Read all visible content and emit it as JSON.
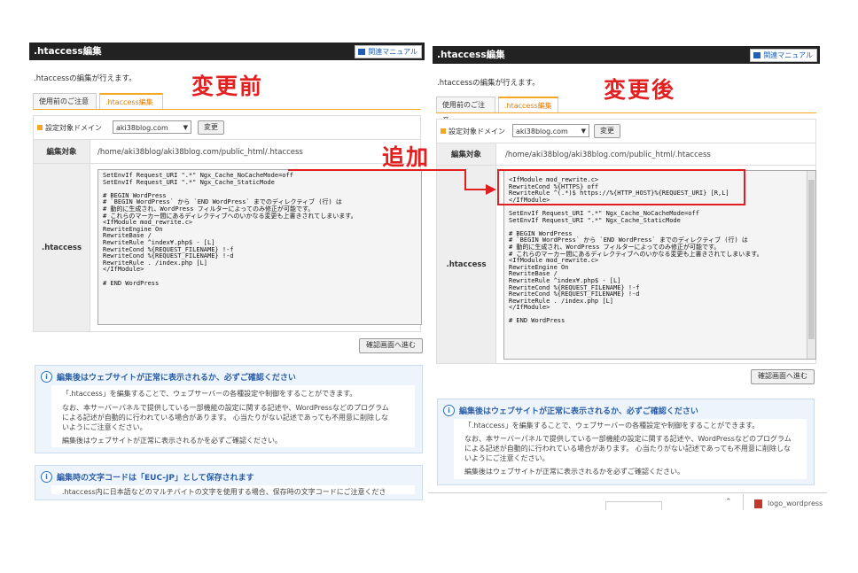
{
  "panel_title": ".htaccess編集",
  "manual_label": "関連マニュアル",
  "description": ".htaccessの編集が行えます。",
  "tabs": {
    "notice": "使用前のご注意",
    "edit": ".htaccess編集"
  },
  "domain_label": "設定対象ドメイン",
  "domain_value": "aki38blog.com",
  "change_button": "変更",
  "target_label": "編集対象",
  "target_path": "/home/aki38blog/aki38blog.com/public_html/.htaccess",
  "htaccess_label": ".htaccess",
  "confirm_button": "確認画面へ進む",
  "annotations": {
    "before": "変更前",
    "after": "変更後",
    "added": "追加"
  },
  "code_before": [
    "SetEnvIf Request_URI \".*\" Ngx_Cache_NoCacheMode=off",
    "SetEnvIf Request_URI \".*\" Ngx_Cache_StaticMode",
    "",
    "# BEGIN WordPress",
    "# `BEGIN WordPress` から `END WordPress` までのディレクティブ (行) は",
    "# 動的に生成され、WordPress フィルターによってのみ修正が可能です。",
    "# これらのマーカー間にあるディレクティブへのいかなる変更も上書きされてしまいます。",
    "<IfModule mod_rewrite.c>",
    "RewriteEngine On",
    "RewriteBase /",
    "RewriteRule ^index¥.php$ - [L]",
    "RewriteCond %{REQUEST_FILENAME} !-f",
    "RewriteCond %{REQUEST_FILENAME} !-d",
    "RewriteRule . /index.php [L]",
    "</IfModule>",
    "",
    "# END WordPress"
  ],
  "code_added": [
    "<IfModule mod_rewrite.c>",
    "RewriteCond %{HTTPS} off",
    "RewriteRule ^(.*)$ https://%{HTTP_HOST}%{REQUEST_URI} [R,L]",
    "</IfModule>"
  ],
  "info1": {
    "title": "編集後はウェブサイトが正常に表示されるか、必ずご確認ください",
    "line1": "「.htaccess」を編集することで、ウェブサーバーの各種設定や制御をすることができます。",
    "line2a": "なお、本サーバーパネルで提供している一部機能の設定に関する記述や、WordPressなどのプログラム",
    "line2b": "による記述が自動的に行われている場合があります。 心当たりがない記述であっても不用意に削除しな",
    "line2c": "いようにご注意ください。",
    "line3": "編集後はウェブサイトが正常に表示されるかを必ずご確認ください。"
  },
  "info2": {
    "title": "編集時の文字コードは「EUC-JP」として保存されます",
    "line1": ".htaccess内に日本語などのマルチバイトの文字を使用する場合、保存時の文字コードにご注意くださ"
  },
  "bottom_right_label": "logo_wordpress",
  "colors": {
    "titlebar": "#222222",
    "accent_orange": "#f5a623",
    "annotation_red": "#e32020",
    "info_blue": "#2a5ea8"
  }
}
